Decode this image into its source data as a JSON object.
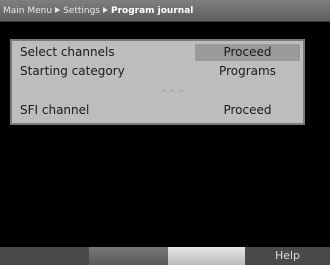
{
  "breadcrumb": {
    "items": [
      "Main Menu",
      "Settings",
      "Program journal"
    ]
  },
  "menu": {
    "rows": [
      {
        "label": "Select channels",
        "value": "Proceed",
        "selected": true
      },
      {
        "label": "Starting category",
        "value": "Programs",
        "selected": false
      },
      {
        "label": "SFI channel",
        "value": "Proceed",
        "selected": false
      }
    ],
    "separator": "– – –"
  },
  "footer": {
    "help_label": "Help"
  },
  "colors": {
    "panel_bg": "#bdbdbd",
    "selected_value_bg": "#9a9a9a",
    "screen_bg": "#000000"
  },
  "icons": {
    "breadcrumb_separator": "triangle-right-icon"
  }
}
